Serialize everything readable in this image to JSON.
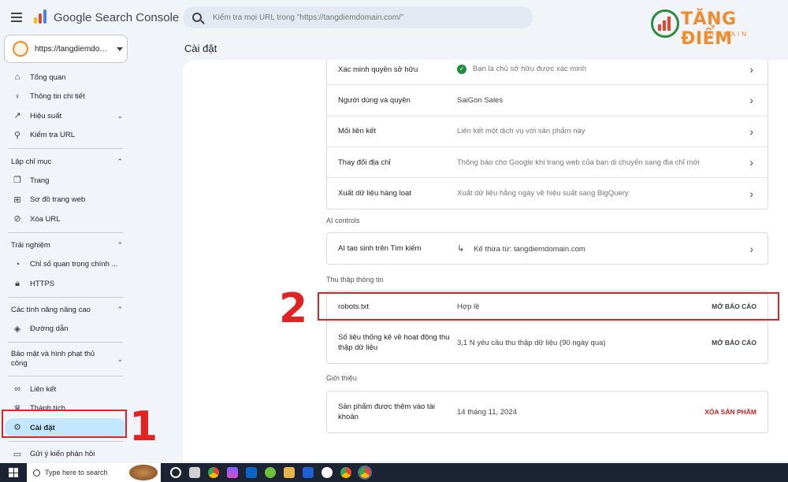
{
  "app": {
    "logo_text": "Google Search Console",
    "search_placeholder": "Kiểm tra mọi URL trong \"https://tangdiemdomain.com/\"",
    "property_url": "https://tangdiemdom..."
  },
  "brand": {
    "title": "TĂNG ĐIỂM",
    "subtitle": "DOMAIN"
  },
  "sidebar": {
    "top_items": [
      {
        "label": "Tổng quan",
        "icon": "home-icon"
      },
      {
        "label": "Thông tin chi tiết",
        "icon": "lightbulb-icon"
      },
      {
        "label": "Hiệu suất",
        "icon": "trending-icon"
      },
      {
        "label": "Kiểm tra URL",
        "icon": "search-icon"
      }
    ],
    "index_section": "Lập chỉ mục",
    "index_items": [
      {
        "label": "Trang",
        "icon": "pages-icon"
      },
      {
        "label": "Sơ đồ trang web",
        "icon": "sitemap-icon"
      },
      {
        "label": "Xóa URL",
        "icon": "eye-off-icon"
      }
    ],
    "experience_section": "Trải nghiệm",
    "experience_items": [
      {
        "label": "Chỉ số quan trọng chính ...",
        "icon": "gauge-icon"
      },
      {
        "label": "HTTPS",
        "icon": "lock-icon"
      }
    ],
    "enhancements_section": "Các tính năng nâng cao",
    "enhancements_items": [
      {
        "label": "Đường dẫn",
        "icon": "breadcrumb-icon"
      }
    ],
    "security_section": "Bảo mật và hình phạt thủ công",
    "bottom_items": [
      {
        "label": "Liên kết",
        "icon": "link-icon"
      },
      {
        "label": "Thành tích",
        "icon": "trophy-icon"
      },
      {
        "label": "Cài đặt",
        "icon": "gear-icon"
      },
      {
        "label": "Gửi ý kiến phản hồi",
        "icon": "feedback-icon"
      }
    ]
  },
  "page": {
    "title": "Cài đặt"
  },
  "settings": {
    "general_rows": [
      {
        "label": "Xác minh quyền sở hữu",
        "desc": "Bạn là chủ sở hữu được xác minh"
      },
      {
        "label": "Người dùng và quyền",
        "desc": "SaiGon Sales"
      },
      {
        "label": "Mối liên kết",
        "desc": "Liên kết một dịch vụ với sản phẩm này"
      },
      {
        "label": "Thay đổi địa chỉ",
        "desc": "Thông báo cho Google khi trang web của bạn di chuyển sang địa chỉ mới"
      },
      {
        "label": "Xuất dữ liệu hàng loạt",
        "desc": "Xuất dữ liệu hằng ngày về hiệu suất sang BigQuery"
      }
    ],
    "ai_section": "AI controls",
    "ai_row": {
      "label": "AI tạo sinh trên Tìm kiếm",
      "desc": "Kế thừa từ: tangdiemdomain.com"
    },
    "crawl_section": "Thu thập thông tin",
    "crawl_rows": [
      {
        "label": "robots.txt",
        "desc": "Hợp lệ",
        "action": "MỞ BÁO CÁO"
      },
      {
        "label": "Số liệu thống kê về hoạt động thu thập dữ liệu",
        "desc": "3,1 N yêu cầu thu thập dữ liệu (90 ngày qua)",
        "action": "MỞ BÁO CÁO"
      }
    ],
    "about_section": "Giới thiệu",
    "about_row": {
      "label": "Sản phẩm được thêm vào tài khoản",
      "desc": "14 tháng 11, 2024",
      "action": "XÓA SẢN PHẨM"
    }
  },
  "annotations": {
    "num1": "1",
    "num2": "2"
  },
  "taskbar": {
    "search_text": "Type here to search"
  },
  "colors": {
    "accent": "#c2e7ff",
    "highlight": "#e02424",
    "brand": "#f18c2e"
  }
}
